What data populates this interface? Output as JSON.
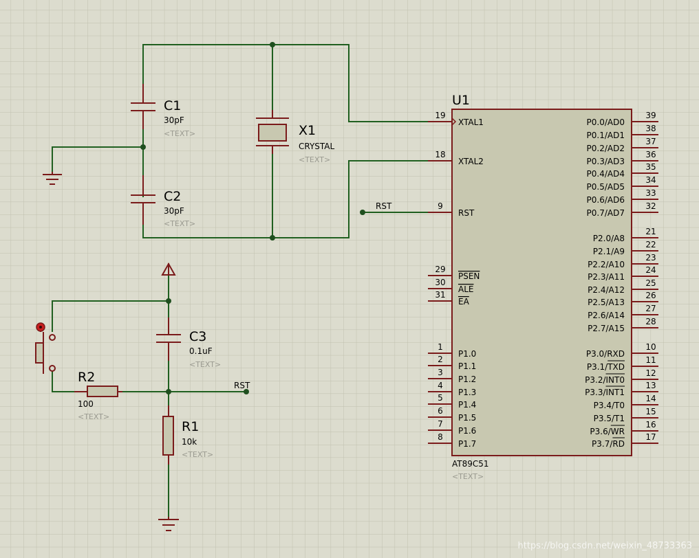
{
  "canvas": {
    "background": "#dcdcce",
    "grid_color": "#bfbfae",
    "wire_color": "#1f5f1f",
    "component_color": "#7a1a1a"
  },
  "components": {
    "c1": {
      "ref": "C1",
      "value": "30pF",
      "text": "<TEXT>"
    },
    "c2": {
      "ref": "C2",
      "value": "30pF",
      "text": "<TEXT>"
    },
    "x1": {
      "ref": "X1",
      "value": "CRYSTAL",
      "text": "<TEXT>"
    },
    "c3": {
      "ref": "C3",
      "value": "0.1uF",
      "text": "<TEXT>"
    },
    "r2": {
      "ref": "R2",
      "value": "100",
      "text": "<TEXT>"
    },
    "r1": {
      "ref": "R1",
      "value": "10k",
      "text": "<TEXT>"
    },
    "u1": {
      "ref": "U1",
      "part": "AT89C51",
      "text": "<TEXT>"
    }
  },
  "net_labels": {
    "rst_top": "RST",
    "rst_bottom": "RST"
  },
  "u1_left_pins": [
    {
      "num": "19",
      "name": "XTAL1"
    },
    {
      "num": "18",
      "name": "XTAL2"
    },
    {
      "num": "9",
      "name": "RST"
    },
    {
      "num": "29",
      "name": "PSEN"
    },
    {
      "num": "30",
      "name": "ALE"
    },
    {
      "num": "31",
      "name": "EA"
    },
    {
      "num": "1",
      "name": "P1.0"
    },
    {
      "num": "2",
      "name": "P1.1"
    },
    {
      "num": "3",
      "name": "P1.2"
    },
    {
      "num": "4",
      "name": "P1.3"
    },
    {
      "num": "5",
      "name": "P1.4"
    },
    {
      "num": "6",
      "name": "P1.5"
    },
    {
      "num": "7",
      "name": "P1.6"
    },
    {
      "num": "8",
      "name": "P1.7"
    }
  ],
  "u1_right_pins": [
    {
      "num": "39",
      "name": "P0.0/AD0"
    },
    {
      "num": "38",
      "name": "P0.1/AD1"
    },
    {
      "num": "37",
      "name": "P0.2/AD2"
    },
    {
      "num": "36",
      "name": "P0.3/AD3"
    },
    {
      "num": "35",
      "name": "P0.4/AD4"
    },
    {
      "num": "34",
      "name": "P0.5/AD5"
    },
    {
      "num": "33",
      "name": "P0.6/AD6"
    },
    {
      "num": "32",
      "name": "P0.7/AD7"
    },
    {
      "num": "21",
      "name": "P2.0/A8"
    },
    {
      "num": "22",
      "name": "P2.1/A9"
    },
    {
      "num": "23",
      "name": "P2.2/A10"
    },
    {
      "num": "24",
      "name": "P2.3/A11"
    },
    {
      "num": "25",
      "name": "P2.4/A12"
    },
    {
      "num": "26",
      "name": "P2.5/A13"
    },
    {
      "num": "27",
      "name": "P2.6/A14"
    },
    {
      "num": "28",
      "name": "P2.7/A15"
    },
    {
      "num": "10",
      "name": "P3.0/RXD"
    },
    {
      "num": "11",
      "name": "P3.1/TXD"
    },
    {
      "num": "12",
      "name": "P3.2/INT0"
    },
    {
      "num": "13",
      "name": "P3.3/INT1"
    },
    {
      "num": "14",
      "name": "P3.4/T0"
    },
    {
      "num": "15",
      "name": "P3.5/T1"
    },
    {
      "num": "16",
      "name": "P3.6/WR"
    },
    {
      "num": "17",
      "name": "P3.7/RD"
    }
  ],
  "watermark": "https://blog.csdn.net/weixin_48733363"
}
